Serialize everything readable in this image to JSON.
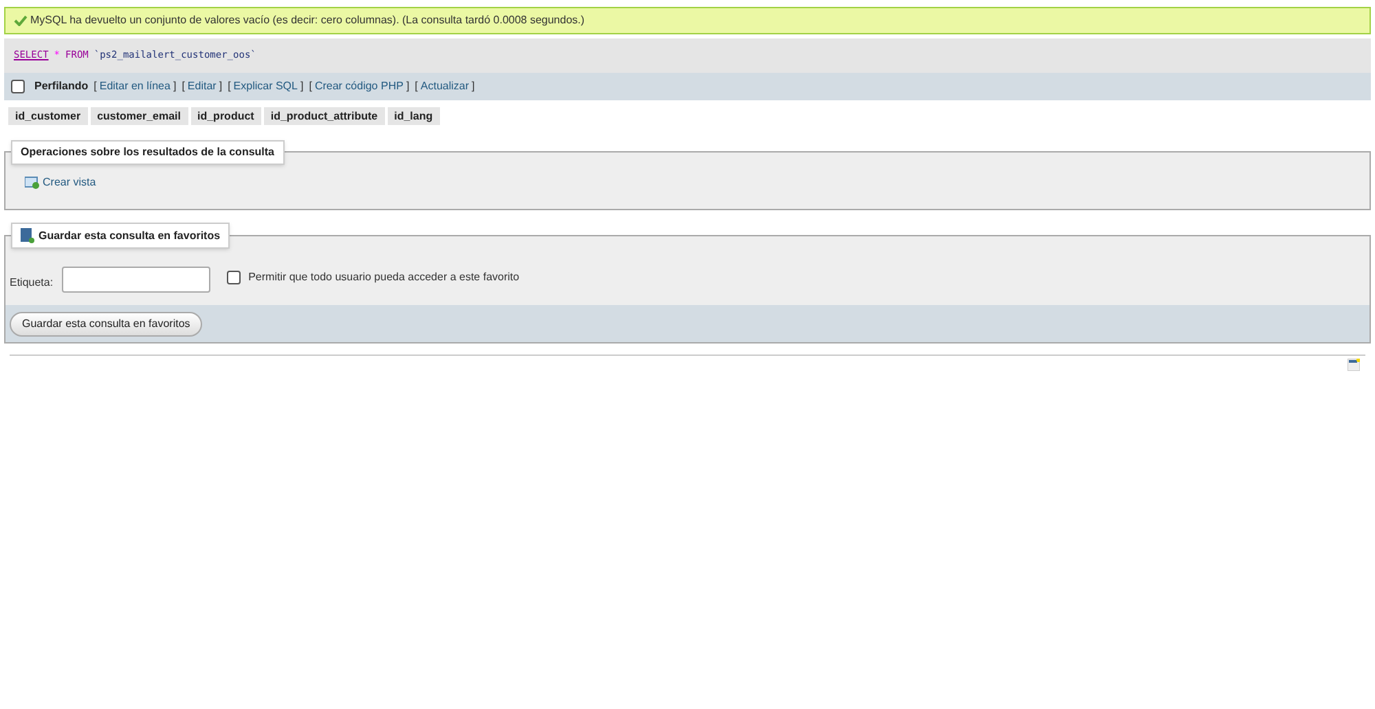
{
  "message": {
    "text": "MySQL ha devuelto un conjunto de valores vacío (es decir: cero columnas). (La consulta tardó 0.0008 segundos.)"
  },
  "query": [
    {
      "kind": "keyword",
      "text": "SELECT"
    },
    {
      "kind": "operator",
      "text": "*"
    },
    {
      "kind": "keyword2",
      "text": "FROM"
    },
    {
      "kind": "name",
      "text": "`ps2_mailalert_customer_oos`"
    }
  ],
  "toolbar": {
    "profiling": {
      "label": "Perfilando",
      "checked": false
    },
    "links": [
      {
        "open": "[",
        "text": "Editar en línea",
        "close": "]"
      },
      {
        "open": "[",
        "text": "Editar",
        "close": "]"
      },
      {
        "open": "[",
        "text": "Explicar SQL",
        "close": "]"
      },
      {
        "open": "[",
        "text": "Crear código PHP",
        "close": "]"
      },
      {
        "open": "[",
        "text": "Actualizar",
        "close": "]"
      }
    ]
  },
  "columns": [
    "id_customer",
    "customer_email",
    "id_product",
    "id_product_attribute",
    "id_lang"
  ],
  "operations": {
    "legend": "Operaciones sobre los resultados de la consulta",
    "links": [
      "Crear vista"
    ]
  },
  "bookmark": {
    "legend": "Guardar esta consulta en favoritos",
    "label": "Etiqueta:",
    "shared": {
      "label": "Permitir que todo usuario pueda acceder a este favorito",
      "checked": false
    },
    "button": "Guardar esta consulta en favoritos"
  }
}
